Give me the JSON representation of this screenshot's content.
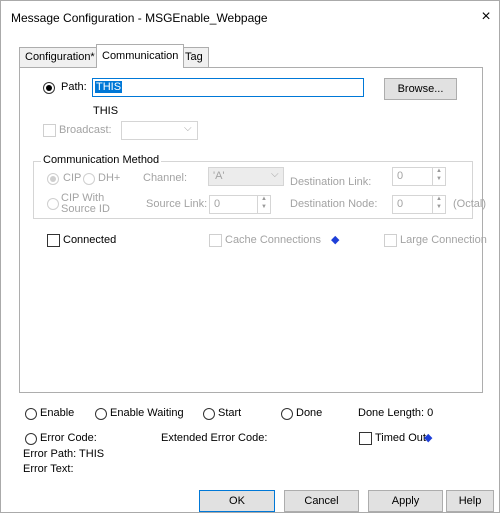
{
  "window": {
    "title": "Message Configuration - MSGEnable_Webpage",
    "close_glyph": "×"
  },
  "tabs": [
    {
      "label": "Configuration*"
    },
    {
      "label": "Communication"
    },
    {
      "label": "Tag"
    }
  ],
  "path": {
    "label": "Path:",
    "value": "THIS",
    "resolved": "THIS",
    "browse_label": "Browse..."
  },
  "broadcast": {
    "label": "Broadcast:",
    "value": ""
  },
  "comm_method": {
    "legend": "Communication Method",
    "cip_label": "CIP",
    "dhplus_label": "DH+",
    "channel_label": "Channel:",
    "channel_value": "'A'",
    "dest_link_label": "Destination Link:",
    "dest_link_value": "0",
    "cip_source_label_1": "CIP With",
    "cip_source_label_2": "Source ID",
    "source_link_label": "Source Link:",
    "source_link_value": "0",
    "dest_node_label": "Destination Node:",
    "dest_node_value": "0",
    "octal_label": "(Octal)"
  },
  "options": {
    "connected_label": "Connected",
    "cache_label": "Cache Connections",
    "large_label": "Large Connection",
    "arrow_glyph": "◆"
  },
  "status": {
    "enable": "Enable",
    "enable_waiting": "Enable Waiting",
    "start": "Start",
    "done": "Done",
    "done_length": "Done Length: 0",
    "error_code": "Error Code:",
    "extended_error_code": "Extended Error Code:",
    "timed_out": "Timed Out",
    "error_path": "Error Path: THIS",
    "error_text": "Error Text:"
  },
  "buttons": {
    "ok": "OK",
    "cancel": "Cancel",
    "apply": "Apply",
    "help": "Help"
  },
  "colors": {
    "accent": "#0078d7",
    "arrow": "#1e3fd8"
  }
}
